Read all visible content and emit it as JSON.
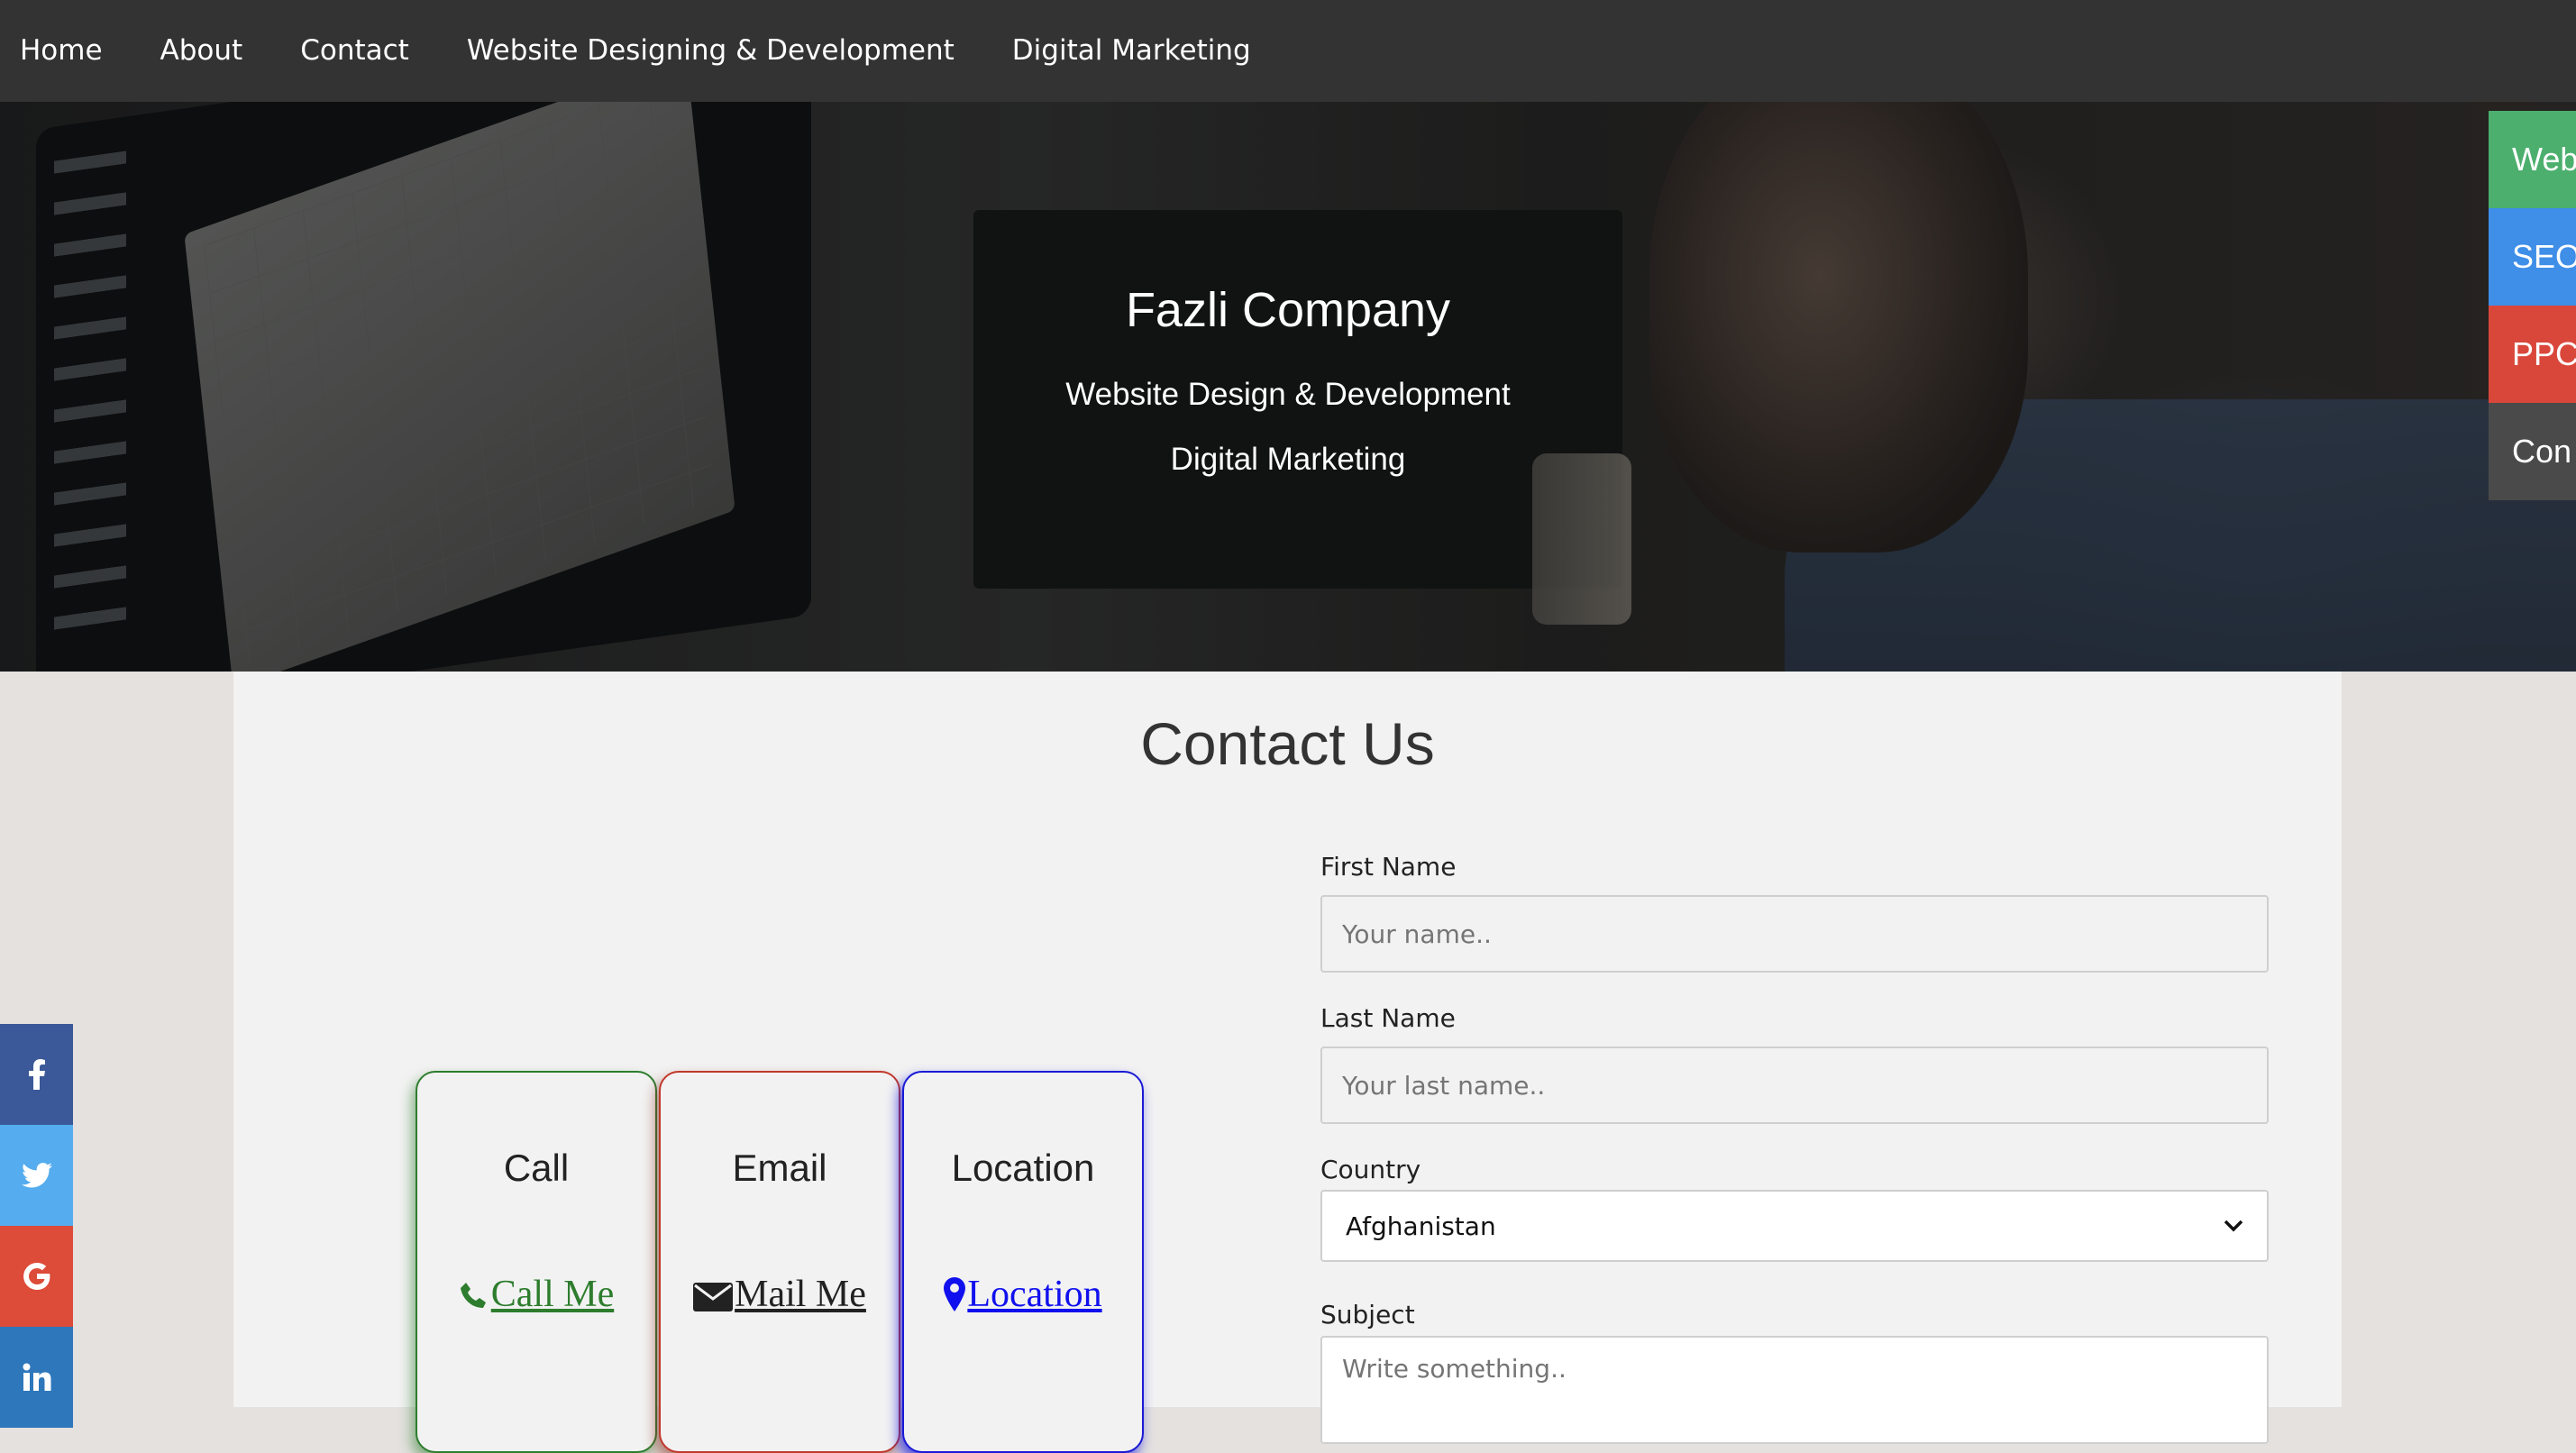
{
  "nav": {
    "items": [
      "Home",
      "About",
      "Contact",
      "Website Designing & Development",
      "Digital Marketing"
    ]
  },
  "hero": {
    "title": "Fazli Company",
    "subtitle1": "Website Design & Development",
    "subtitle2": "Digital Marketing"
  },
  "right_tabs": [
    {
      "label": "Web",
      "color": "#4caf6e"
    },
    {
      "label": "SEO",
      "color": "#3f8ee8"
    },
    {
      "label": "PPC",
      "color": "#d9473a"
    },
    {
      "label": "Con",
      "color": "#4a4a4a"
    }
  ],
  "social": [
    {
      "icon": "facebook-icon",
      "glyph": "f",
      "color": "#3b5998"
    },
    {
      "icon": "twitter-icon",
      "glyph": "t",
      "color": "#55acee"
    },
    {
      "icon": "google-icon",
      "glyph": "G",
      "color": "#dd4b39"
    },
    {
      "icon": "linkedin-icon",
      "glyph": "in",
      "color": "#2e77bb"
    }
  ],
  "main": {
    "title": "Contact Us"
  },
  "cards": {
    "call": {
      "title": "Call",
      "link": "Call Me"
    },
    "email": {
      "title": "Email",
      "link": "Mail Me"
    },
    "location": {
      "title": "Location",
      "link": "Location"
    }
  },
  "form": {
    "first_name_label": "First Name",
    "first_name_placeholder": "Your name..",
    "last_name_label": "Last Name",
    "last_name_placeholder": "Your last name..",
    "country_label": "Country",
    "country_value": "Afghanistan",
    "subject_label": "Subject",
    "subject_placeholder": "Write something.."
  }
}
